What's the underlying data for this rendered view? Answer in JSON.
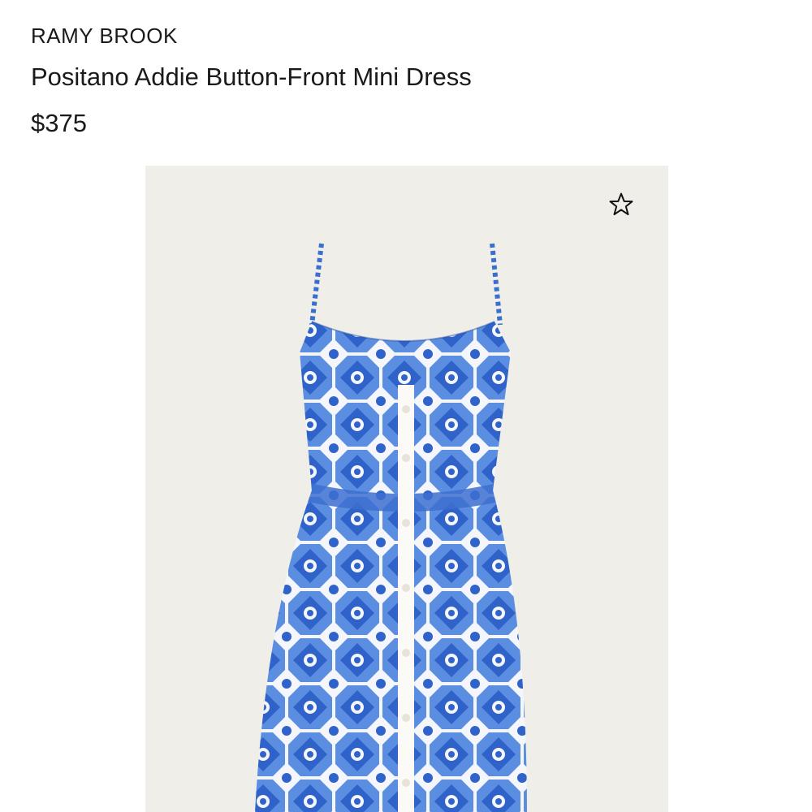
{
  "product": {
    "brand": "RAMY BROOK",
    "name": "Positano Addie Button-Front Mini Dress",
    "price": "$375"
  },
  "image": {
    "background_color": "#efeee9",
    "subject": "dress-photo",
    "print_colors": [
      "#2f63c9",
      "#5b8ee0",
      "#f4f6fb"
    ]
  },
  "favorite": {
    "icon": "star-outline-icon",
    "selected": false
  }
}
